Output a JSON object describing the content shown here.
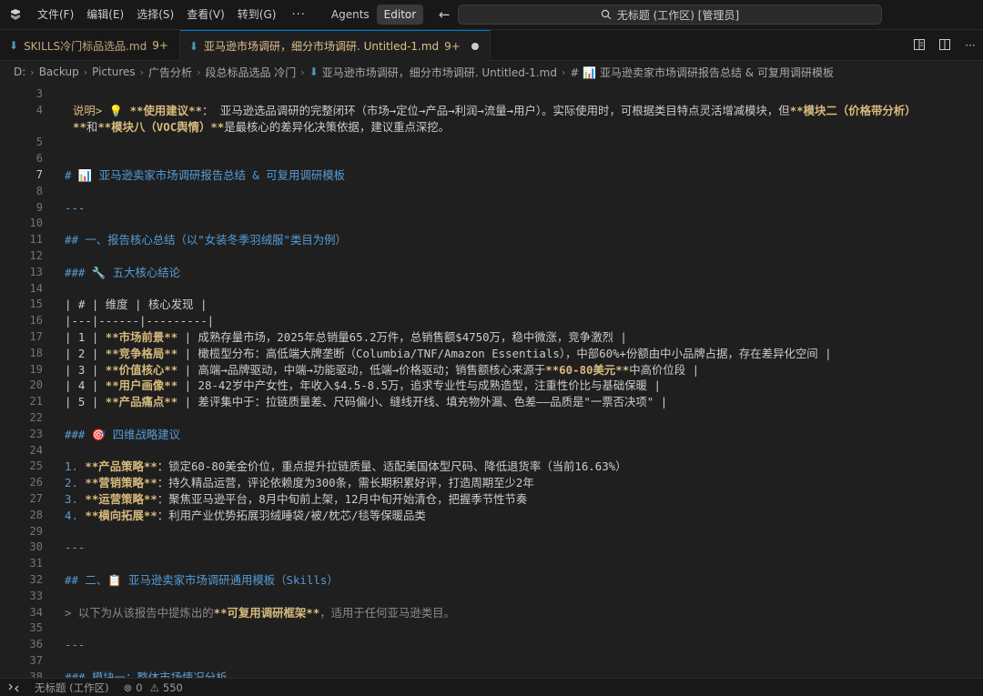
{
  "titlebar": {
    "menu": [
      "文件(F)",
      "编辑(E)",
      "选择(S)",
      "查看(V)",
      "转到(G)"
    ],
    "more": "···",
    "modes": [
      "Agents",
      "Editor"
    ],
    "active_mode": "Editor",
    "command_center": "无标题 (工作区) [管理员]"
  },
  "tabs": [
    {
      "label": "SKILLS冷门标品选品.md",
      "count": "9+",
      "active": false
    },
    {
      "label": "亚马逊市场调研，细分市场调研. Untitled-1.md",
      "count": "9+",
      "active": true
    }
  ],
  "breadcrumb": [
    "D:",
    "Backup",
    "Pictures",
    "广告分析",
    "段总标品选品 冷门",
    "亚马逊市场调研，细分市场调研. Untitled-1.md",
    "# 📊 亚马逊卖家市场调研报告总结 & 可复用调研模板"
  ],
  "editor": {
    "lines": [
      {
        "n": "3",
        "segments": []
      },
      {
        "n": "4",
        "segments": [
          {
            "t": "说明> 💡 ",
            "c": "bd"
          },
          {
            "t": "**使用建议**",
            "c": "bold"
          },
          {
            "t": "： 亚马逊选品调研的完整闭环（市场→定位→产品→利润→流量→用户）。实际使用时，可根据类目特点灵活增减模块，但",
            "c": ""
          },
          {
            "t": "**模块二（价格带分析）",
            "c": "bold"
          }
        ]
      },
      {
        "n": "",
        "segments": [
          {
            "t": "**",
            "c": "bold"
          },
          {
            "t": "和",
            "c": ""
          },
          {
            "t": "**模块八（VOC舆情）**",
            "c": "bold"
          },
          {
            "t": "是最核心的差异化决策依据，建议重点深挖。",
            "c": ""
          }
        ]
      },
      {
        "n": "5",
        "segments": []
      },
      {
        "n": "6",
        "segments": []
      },
      {
        "n": "7",
        "segments": [
          {
            "t": "# 📊 亚马逊卖家市场调研报告总结 & 可复用调研模板",
            "c": "h"
          }
        ]
      },
      {
        "n": "8",
        "segments": []
      },
      {
        "n": "9",
        "segments": [
          {
            "t": "---",
            "c": "h"
          }
        ]
      },
      {
        "n": "10",
        "segments": []
      },
      {
        "n": "11",
        "segments": [
          {
            "t": "## 一、报告核心总结（以\"女装冬季羽绒服\"类目为例）",
            "c": "h"
          }
        ]
      },
      {
        "n": "12",
        "segments": []
      },
      {
        "n": "13",
        "segments": [
          {
            "t": "### 🔧 五大核心结论",
            "c": "h"
          }
        ]
      },
      {
        "n": "14",
        "segments": []
      },
      {
        "n": "15",
        "segments": [
          {
            "t": "| # | 维度 | 核心发现 |",
            "c": ""
          }
        ]
      },
      {
        "n": "16",
        "segments": [
          {
            "t": "|---|------|---------|",
            "c": ""
          }
        ]
      },
      {
        "n": "17",
        "segments": [
          {
            "t": "| 1 | ",
            "c": ""
          },
          {
            "t": "**市场前景**",
            "c": "bold"
          },
          {
            "t": " | 成熟存量市场，2025年总销量65.2万件，总销售额$4750万，稳中微涨，竞争激烈 |",
            "c": ""
          }
        ]
      },
      {
        "n": "18",
        "segments": [
          {
            "t": "| 2 | ",
            "c": ""
          },
          {
            "t": "**竞争格局**",
            "c": "bold"
          },
          {
            "t": " | 橄榄型分布：高低端大牌垄断（Columbia/TNF/Amazon Essentials），中部60%+份额由中小品牌占据，存在差异化空间 |",
            "c": ""
          }
        ]
      },
      {
        "n": "19",
        "segments": [
          {
            "t": "| 3 | ",
            "c": ""
          },
          {
            "t": "**价值核心**",
            "c": "bold"
          },
          {
            "t": " | 高端→品牌驱动，中端→功能驱动，低端→价格驱动；销售额核心来源于",
            "c": ""
          },
          {
            "t": "**60-80美元**",
            "c": "bold"
          },
          {
            "t": "中高价位段 |",
            "c": ""
          }
        ]
      },
      {
        "n": "20",
        "segments": [
          {
            "t": "| 4 | ",
            "c": ""
          },
          {
            "t": "**用户画像**",
            "c": "bold"
          },
          {
            "t": " | 28-42岁中产女性，年收入$4.5-8.5万，追求专业性与成熟造型，注重性价比与基础保暖 |",
            "c": ""
          }
        ]
      },
      {
        "n": "21",
        "segments": [
          {
            "t": "| 5 | ",
            "c": ""
          },
          {
            "t": "**产品痛点**",
            "c": "bold"
          },
          {
            "t": " | 差评集中于：拉链质量差、尺码偏小、缝线开线、填充物外漏、色差——品质是\"一票否决项\" |",
            "c": ""
          }
        ]
      },
      {
        "n": "22",
        "segments": []
      },
      {
        "n": "23",
        "segments": [
          {
            "t": "### 🎯 四维战略建议",
            "c": "h"
          }
        ]
      },
      {
        "n": "24",
        "segments": []
      },
      {
        "n": "25",
        "segments": [
          {
            "t": "1. ",
            "c": "h"
          },
          {
            "t": "**产品策略**",
            "c": "bold"
          },
          {
            "t": "：锁定60-80美金价位，重点提升拉链质量、适配美国体型尺码、降低退货率（当前16.63%）",
            "c": ""
          }
        ]
      },
      {
        "n": "26",
        "segments": [
          {
            "t": "2. ",
            "c": "h"
          },
          {
            "t": "**营销策略**",
            "c": "bold"
          },
          {
            "t": "：持久精品运营，评论依赖度为300条，需长期积累好评，打造周期至少2年",
            "c": ""
          }
        ]
      },
      {
        "n": "27",
        "segments": [
          {
            "t": "3. ",
            "c": "h"
          },
          {
            "t": "**运营策略**",
            "c": "bold"
          },
          {
            "t": "：聚焦亚马逊平台，8月中旬前上架，12月中旬开始清仓，把握季节性节奏",
            "c": ""
          }
        ]
      },
      {
        "n": "28",
        "segments": [
          {
            "t": "4. ",
            "c": "h"
          },
          {
            "t": "**横向拓展**",
            "c": "bold"
          },
          {
            "t": "：利用产业优势拓展羽绒睡袋/被/枕芯/毯等保暖品类",
            "c": ""
          }
        ]
      },
      {
        "n": "29",
        "segments": []
      },
      {
        "n": "30",
        "segments": [
          {
            "t": "---",
            "c": "h"
          }
        ]
      },
      {
        "n": "31",
        "segments": []
      },
      {
        "n": "32",
        "segments": [
          {
            "t": "## 二、📋 亚马逊卖家市场调研通用模板（Skills）",
            "c": "h"
          }
        ]
      },
      {
        "n": "33",
        "segments": []
      },
      {
        "n": "34",
        "segments": [
          {
            "t": "> 以下为从该报告中提炼出的",
            "c": "quote"
          },
          {
            "t": "**可复用调研框架**",
            "c": "bold"
          },
          {
            "t": "，适用于任何亚马逊类目。",
            "c": "quote"
          }
        ]
      },
      {
        "n": "35",
        "segments": []
      },
      {
        "n": "36",
        "segments": [
          {
            "t": "---",
            "c": "h"
          }
        ]
      },
      {
        "n": "37",
        "segments": []
      },
      {
        "n": "38",
        "segments": [
          {
            "t": "### 模块一：整体市场情况分析",
            "c": "h"
          }
        ]
      }
    ]
  },
  "statusbar": {
    "workspace": "无标题 (工作区)",
    "errors": "0",
    "warnings": "550"
  }
}
